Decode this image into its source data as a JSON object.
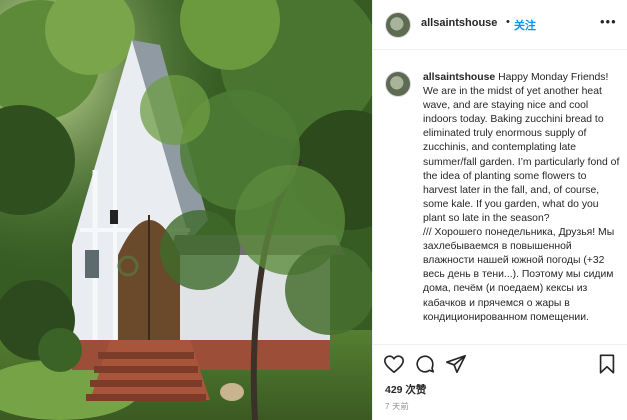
{
  "header": {
    "username": "allsaintshouse",
    "separator": "•",
    "follow_label": "关注",
    "more_icon": "more-horizontal-icon"
  },
  "caption": {
    "username": "allsaintshouse",
    "text": "Happy Monday Friends! We are in the midst of yet another heat wave, and are staying nice and cool indoors today. Baking zucchini bread to eliminated truly enormous supply of zucchinis, and contemplating late summer/fall garden. I’m particularly fond of the idea of planting some flowers to harvest later in the fall, and, of course, some kale. If you garden, what do you plant so late in the season?\n/// Хорошего понедельника, Друзья! Мы захлебываемся в повышенной влажности нашей южной погоды (+32 весь день в тени...). Поэтому мы сидим дома, печём (и поедаем) кексы из кабачков и прячемся о жары в кондиционированном помещении."
  },
  "actions": {
    "like_icon": "heart-icon",
    "comment_icon": "comment-bubble-icon",
    "share_icon": "paper-plane-icon",
    "save_icon": "bookmark-icon",
    "likes_text": "429 次赞",
    "time_ago": "7 天前"
  },
  "colors": {
    "link": "#0095f6",
    "text": "#262626",
    "muted": "#8e8e8e",
    "border": "#efefef"
  }
}
